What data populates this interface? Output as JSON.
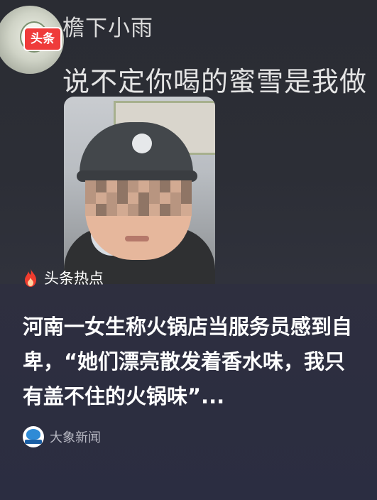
{
  "comment": {
    "commenter_name": "檐下小雨",
    "text": "说不定你喝的蜜雪是我做",
    "app_badge": "头条"
  },
  "hot_label": "头条热点",
  "headline": "河南一女生称火锅店当服务员感到自卑，“她们漂亮散发着香水味，我只有盖不住的火锅味”...",
  "source": {
    "name": "大象新闻"
  },
  "colors": {
    "badge_red": "#ef3b3a",
    "flame_red": "#f03c2e",
    "background": "#2e2f3f"
  },
  "icons": {
    "hot": "flame-icon",
    "source": "dxnews-logo-icon"
  }
}
